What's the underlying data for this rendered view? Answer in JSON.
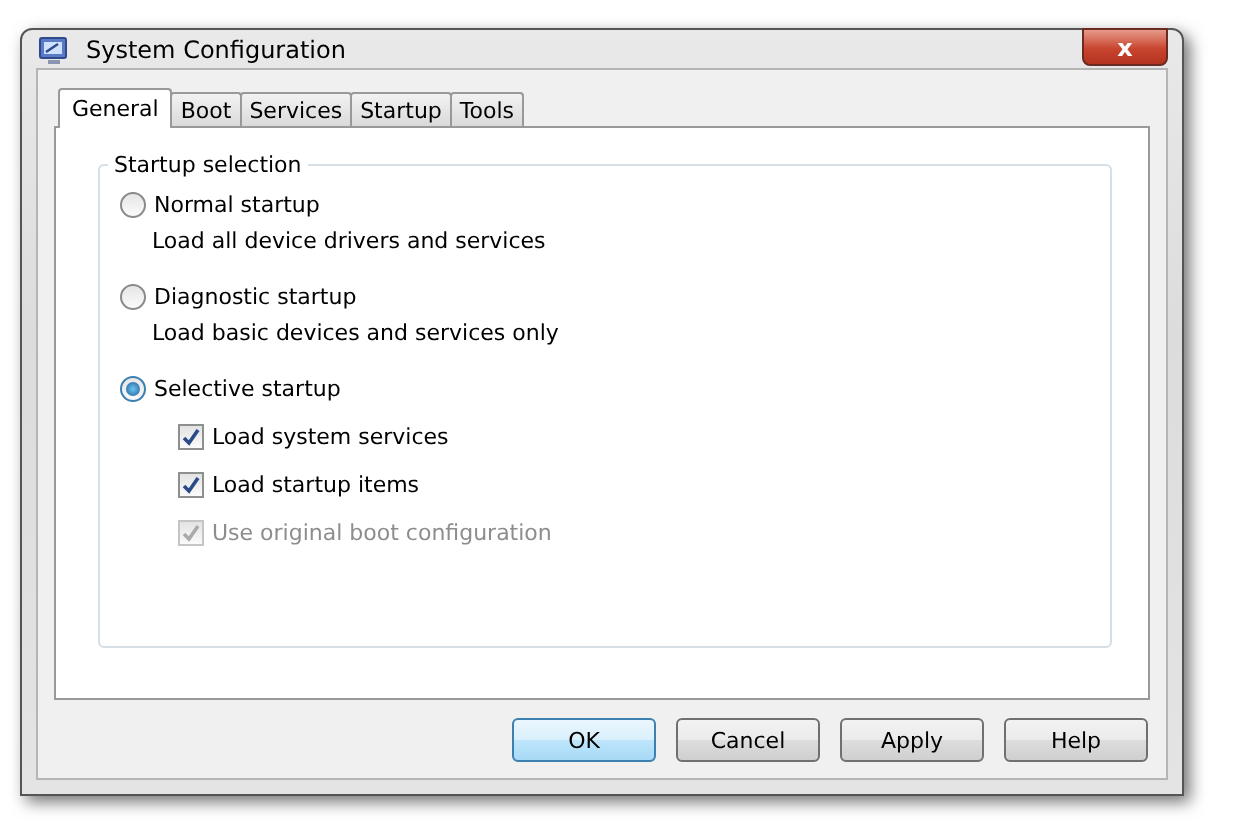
{
  "window": {
    "title": "System Configuration",
    "close_label": "x"
  },
  "tabs": [
    {
      "label": "General",
      "selected": true
    },
    {
      "label": "Boot",
      "selected": false
    },
    {
      "label": "Services",
      "selected": false
    },
    {
      "label": "Startup",
      "selected": false
    },
    {
      "label": "Tools",
      "selected": false
    }
  ],
  "group": {
    "title": "Startup selection",
    "options": [
      {
        "label": "Normal startup",
        "description": "Load all device drivers and services",
        "selected": false
      },
      {
        "label": "Diagnostic startup",
        "description": "Load basic devices and services only",
        "selected": false
      },
      {
        "label": "Selective startup",
        "selected": true,
        "checkboxes": [
          {
            "label": "Load system services",
            "checked": true,
            "disabled": false
          },
          {
            "label": "Load startup items",
            "checked": true,
            "disabled": false
          },
          {
            "label": "Use original boot configuration",
            "checked": true,
            "disabled": true
          }
        ]
      }
    ]
  },
  "buttons": [
    {
      "label": "OK",
      "default": true
    },
    {
      "label": "Cancel",
      "default": false
    },
    {
      "label": "Apply",
      "default": false
    },
    {
      "label": "Help",
      "default": false
    }
  ]
}
